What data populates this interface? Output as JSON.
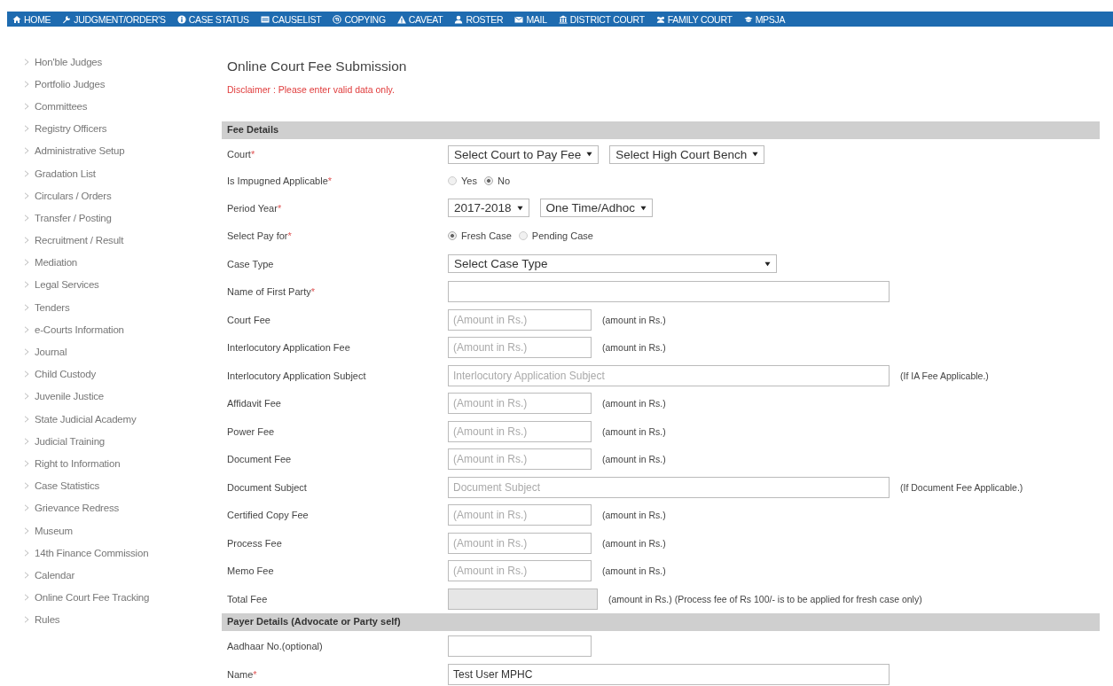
{
  "nav": [
    {
      "label": "HOME"
    },
    {
      "label": "JUDGMENT/ORDER'S"
    },
    {
      "label": "CASE STATUS"
    },
    {
      "label": "CAUSELIST"
    },
    {
      "label": "COPYING"
    },
    {
      "label": "CAVEAT"
    },
    {
      "label": "ROSTER"
    },
    {
      "label": "MAIL"
    },
    {
      "label": "DISTRICT COURT"
    },
    {
      "label": "FAMILY COURT"
    },
    {
      "label": "MPSJA"
    }
  ],
  "sidebar": {
    "items": [
      "Hon'ble Judges",
      "Portfolio Judges",
      "Committees",
      "Registry Officers",
      "Administrative Setup",
      "Gradation List",
      "Circulars / Orders",
      "Transfer / Posting",
      "Recruitment / Result",
      "Mediation",
      "Legal Services",
      "Tenders",
      "e-Courts Information",
      "Journal",
      "Child Custody",
      "Juvenile Justice",
      "State Judicial Academy",
      "Judicial Training",
      "Right to Information",
      "Case Statistics",
      "Grievance Redress",
      "Museum",
      "14th Finance Commission",
      "Calendar",
      "Online Court Fee Tracking",
      "Rules"
    ]
  },
  "form": {
    "title": "Online Court Fee Submission",
    "disclaimer": "Disclaimer : Please enter valid data only.",
    "sections": [
      {
        "heading": "Fee Details",
        "rows": [
          {
            "kind": "selects",
            "label": "Court",
            "required_mark": "*",
            "selects": [
              {
                "value": "Select Court to Pay Fee"
              },
              {
                "value": "Select High Court Bench"
              }
            ]
          },
          {
            "kind": "radios",
            "label": "Is Impugned Applicable",
            "required_mark": "*",
            "options": [
              {
                "label": "Yes",
                "selected": false
              },
              {
                "label": "No",
                "selected": true
              }
            ]
          },
          {
            "kind": "selects",
            "label": "Period Year",
            "required_mark": "*",
            "selects": [
              {
                "value": "2017-2018"
              },
              {
                "value": "One Time/Adhoc"
              }
            ]
          },
          {
            "kind": "radios",
            "label": "Select Pay for",
            "required_mark": "*",
            "options": [
              {
                "label": "Fresh Case",
                "selected": true
              },
              {
                "label": "Pending Case",
                "selected": false
              }
            ]
          },
          {
            "kind": "wide-select",
            "label": "Case Type",
            "value": "Select Case Type"
          },
          {
            "kind": "input",
            "label": "Name of First Party",
            "required_mark": "*",
            "wide": true,
            "disabled": false
          },
          {
            "kind": "input",
            "label": "Court Fee",
            "placeholder": "(Amount in Rs.)",
            "note": "(amount in Rs.)",
            "wide": false,
            "disabled": false
          },
          {
            "kind": "input",
            "label": "Interlocutory Application Fee",
            "placeholder": "(Amount in Rs.)",
            "note": "(amount in Rs.)",
            "wide": false,
            "disabled": false
          },
          {
            "kind": "input",
            "label": "Interlocutory Application Subject",
            "placeholder": "Interlocutory Application Subject",
            "note": "(If IA Fee Applicable.)",
            "wide": true,
            "disabled": false
          },
          {
            "kind": "input",
            "label": "Affidavit Fee",
            "placeholder": "(Amount in Rs.)",
            "note": "(amount in Rs.)",
            "wide": false,
            "disabled": false
          },
          {
            "kind": "input",
            "label": "Power Fee",
            "placeholder": "(Amount in Rs.)",
            "note": "(amount in Rs.)",
            "wide": false,
            "disabled": false
          },
          {
            "kind": "input",
            "label": "Document Fee",
            "placeholder": "(Amount in Rs.)",
            "note": "(amount in Rs.)",
            "wide": false,
            "disabled": false
          },
          {
            "kind": "input",
            "label": "Document Subject",
            "placeholder": "Document Subject",
            "note": "(If Document Fee Applicable.)",
            "wide": true,
            "disabled": false
          },
          {
            "kind": "input",
            "label": "Certified Copy Fee",
            "placeholder": "(Amount in Rs.)",
            "note": "(amount in Rs.)",
            "wide": false,
            "disabled": false
          },
          {
            "kind": "input",
            "label": "Process Fee",
            "placeholder": "(Amount in Rs.)",
            "note": "(amount in Rs.)",
            "wide": false,
            "disabled": false
          },
          {
            "kind": "input",
            "label": "Memo Fee",
            "placeholder": "(Amount in Rs.)",
            "note": "(amount in Rs.)",
            "wide": false,
            "disabled": false
          },
          {
            "kind": "input",
            "label": "Total Fee",
            "note": "(amount in Rs.) (Process fee of Rs 100/- is to be applied for fresh case only)",
            "wide": false,
            "disabled": true
          }
        ]
      },
      {
        "heading": "Payer Details (Advocate or Party self)",
        "rows": [
          {
            "kind": "input",
            "label": "Aadhaar No.(optional)",
            "wide": false,
            "disabled": false
          },
          {
            "kind": "input",
            "label": "Name",
            "required_mark": "*",
            "value": "Test User MPHC",
            "wide": true,
            "disabled": false
          }
        ]
      }
    ]
  }
}
